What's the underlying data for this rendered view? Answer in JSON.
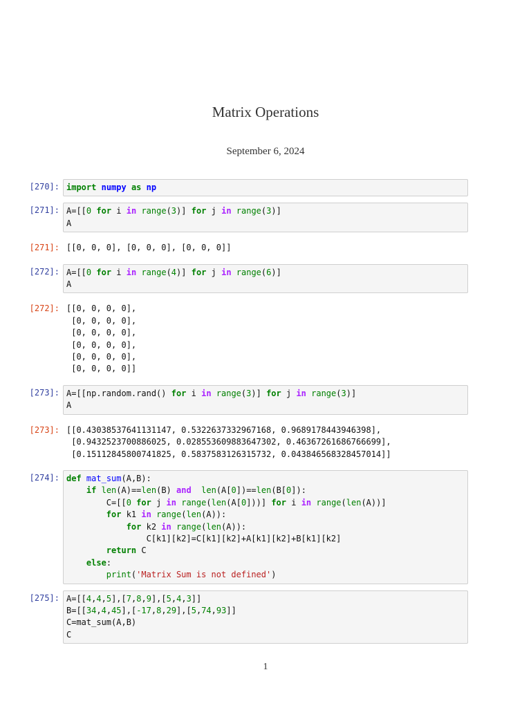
{
  "document": {
    "title": "Matrix Operations",
    "date": "September 6, 2024",
    "page_number": "1"
  },
  "cells": {
    "c270": {
      "prompt": "[270]:"
    },
    "c271": {
      "prompt": "[271]:",
      "output_prompt": "[271]:",
      "output": "[[0, 0, 0], [0, 0, 0], [0, 0, 0]]"
    },
    "c272": {
      "prompt": "[272]:",
      "output_prompt": "[272]:",
      "output": "[[0, 0, 0, 0],\n [0, 0, 0, 0],\n [0, 0, 0, 0],\n [0, 0, 0, 0],\n [0, 0, 0, 0],\n [0, 0, 0, 0]]"
    },
    "c273": {
      "prompt": "[273]:",
      "output_prompt": "[273]:",
      "output": "[[0.43038537641131147, 0.5322637332967168, 0.9689178443946398],\n [0.9432523700886025, 0.028553609883647302, 0.46367261686766699],\n [0.15112845800741825, 0.5837583126315732, 0.043846568328457014]]"
    },
    "c274": {
      "prompt": "[274]:"
    },
    "c275": {
      "prompt": "[275]:"
    }
  }
}
